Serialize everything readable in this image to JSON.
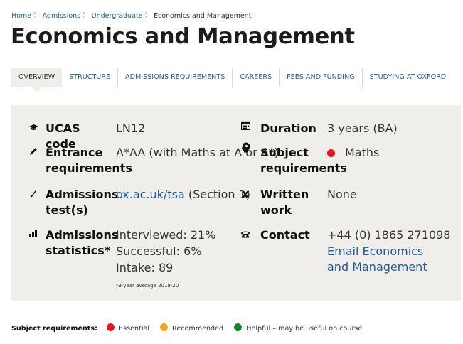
{
  "breadcrumb": [
    "Home",
    "Admissions",
    "Undergraduate",
    "Economics and Management"
  ],
  "page_title": "Economics and Management",
  "tabs": [
    "OVERVIEW",
    "STRUCTURE",
    "ADMISSIONS REQUIREMENTS",
    "CAREERS",
    "FEES AND FUNDING",
    "STUDYING AT OXFORD"
  ],
  "active_tab": "OVERVIEW",
  "facts": {
    "ucas": {
      "label": "UCAS code",
      "value": "LN12",
      "icon": "mortarboard-icon"
    },
    "entrance": {
      "label": "Entrance requirements",
      "value": "A*AA (with Maths at A or A*)",
      "icon": "pencil-icon"
    },
    "test": {
      "label": "Admissions test(s)",
      "link": "ox.ac.uk/tsa",
      "suffix": " (Section 1)",
      "icon": "checkmark-icon"
    },
    "stats": {
      "label": "Admissions statistics*",
      "lines": [
        "Interviewed: 21%",
        "Successful: 6%",
        "Intake: 89"
      ],
      "note": "*3-year average 2018-20",
      "icon": "bar-chart-icon"
    },
    "duration": {
      "label": "Duration",
      "value": "3 years (BA)",
      "icon": "calendar-icon"
    },
    "subject": {
      "label": "Subject requirements",
      "value": "Maths",
      "status": "essential",
      "icon": "head-icon"
    },
    "written": {
      "label": "Written work",
      "value": "None",
      "icon": "cross-icon"
    },
    "contact": {
      "label": "Contact",
      "phone": "+44 (0) 1865 271098",
      "email_link": "Email Economics and Management",
      "icon": "telephone-icon"
    }
  },
  "legend": {
    "title": "Subject requirements:",
    "items": [
      {
        "label": "Essential",
        "color": "#e8141c"
      },
      {
        "label": "Recommended",
        "color": "#f4a31b"
      },
      {
        "label": "Helpful – may be useful on course",
        "color": "#0d8a2b"
      }
    ]
  },
  "colors": {
    "link": "#1d5a9a",
    "panel": "#efeeea",
    "essential": "#e8141c",
    "recommended": "#f4a31b",
    "helpful": "#0d8a2b"
  }
}
